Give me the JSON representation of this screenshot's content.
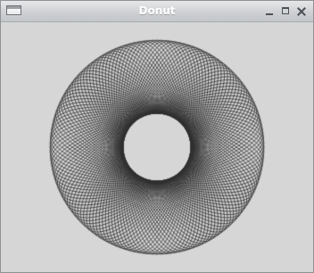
{
  "window": {
    "title": "Donut",
    "app_icon": "window-icon",
    "controls": [
      {
        "name": "minimize",
        "icon": "minimize-icon"
      },
      {
        "name": "maximize",
        "icon": "maximize-icon"
      },
      {
        "name": "close",
        "icon": "close-icon"
      }
    ]
  },
  "colors": {
    "titlebar_text": "#ffffff",
    "canvas_background": "#d6d6d6",
    "stroke": "#2f2f2f"
  },
  "donut": {
    "ellipse_count": 72
  }
}
